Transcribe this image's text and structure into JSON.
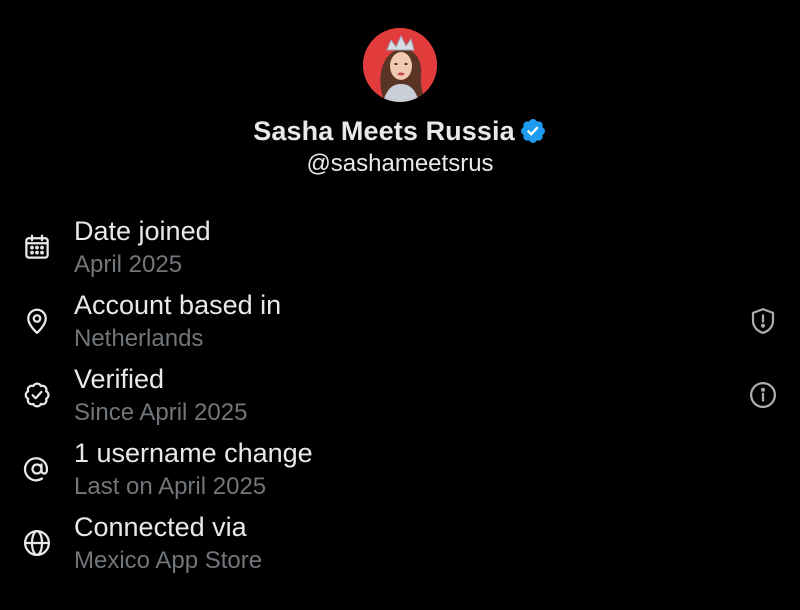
{
  "profile": {
    "display_name": "Sasha Meets Russia",
    "handle": "@sashameetsrus",
    "verified": true,
    "avatar_icon": "profile-photo",
    "avatar_background": "#e23b3b",
    "badge_color": "#1d9bf0"
  },
  "rows": [
    {
      "title": "Date joined",
      "subtitle": "April 2025",
      "icon": "calendar-icon"
    },
    {
      "title": "Account based in",
      "subtitle": "Netherlands",
      "icon": "location-pin-icon",
      "trailing_icon": "shield-alert-icon"
    },
    {
      "title": "Verified",
      "subtitle": "Since April 2025",
      "icon": "verified-check-icon",
      "trailing_icon": "info-icon"
    },
    {
      "title": "1 username change",
      "subtitle": "Last on April 2025",
      "icon": "at-sign-icon"
    },
    {
      "title": "Connected via",
      "subtitle": "Mexico App Store",
      "icon": "globe-icon"
    }
  ],
  "colors": {
    "background": "#000000",
    "primary_text": "#e7e9ea",
    "secondary_text": "#71767b",
    "accent": "#1d9bf0"
  }
}
